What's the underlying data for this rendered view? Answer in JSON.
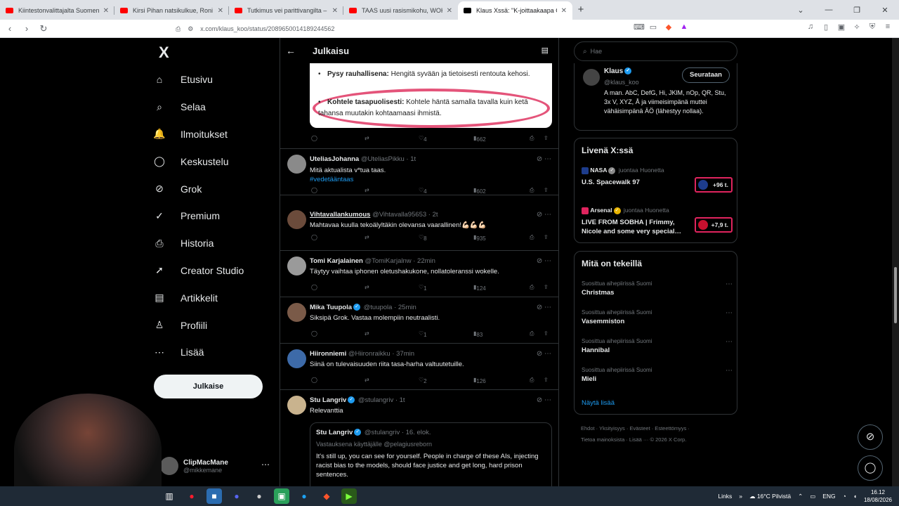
{
  "browser": {
    "tabs": [
      {
        "title": "Kiintestonvalittajalta Suomen suur",
        "fav": "#ff0000"
      },
      {
        "title": "Kirsi Pihan natsikulkue, Roni heittelli",
        "fav": "#ff0000"
      },
      {
        "title": "Tutkimus vei parittivangilta – Atte Ka",
        "fav": "#ff0000"
      },
      {
        "title": "TAAS uusi rasismikohu, WOKE-profe",
        "fav": "#ff0000"
      },
      {
        "title": "Klaus Xssä: \"K-joittaakaapa Goog",
        "fav": "#000000"
      }
    ],
    "new_tab": "+",
    "url": "x.com/klaus_koo/status/2089650014189244562"
  },
  "x": {
    "logo": "X",
    "nav": [
      {
        "label": "Etusivu",
        "icon": "⌂"
      },
      {
        "label": "Selaa",
        "icon": "⌕"
      },
      {
        "label": "Ilmoitukset",
        "icon": "🔔"
      },
      {
        "label": "Keskustelu",
        "icon": "◯"
      },
      {
        "label": "Grok",
        "icon": "⊘"
      },
      {
        "label": "Premium",
        "icon": "✓"
      },
      {
        "label": "Historia",
        "icon": "⎙"
      },
      {
        "label": "Creator Studio",
        "icon": "➚"
      },
      {
        "label": "Artikkelit",
        "icon": "▤"
      },
      {
        "label": "Profiili",
        "icon": "♙"
      },
      {
        "label": "Lisää",
        "icon": "⋯"
      }
    ],
    "post_button": "Julkaise",
    "account": {
      "name": "ClipMacMane",
      "handle": "@mikkemane"
    }
  },
  "main": {
    "header_title": "Julkaisu",
    "image": {
      "line1_bold": "Pysy rauhallisena:",
      "line1_text": " Hengitä syvään ja tietoisesti rentouta kehosi.",
      "line2_bold": "Kohtele tasapuolisesti:",
      "line2_text": " Kohtele häntä samalla tavalla kuin ketä tahansa muutakin kohtaamaasi ihmistä."
    },
    "first_actions": {
      "likes": "4",
      "views": "662"
    },
    "replies": [
      {
        "name": "UteliasJohanna",
        "handle": "@UteliasPikku · 1t",
        "text": "Mitä aktualista v*tua taas.",
        "tag": "#vedetääntaas",
        "likes": "4",
        "views": "602"
      },
      {
        "name": "Vihtavallankumous",
        "handle": "@Vihtavalla95653 · 2t",
        "text": "Mahtavaa kuulla tekoälyltäkin olevansa vaarallinen!💪🏻💪🏻💪🏻",
        "likes": "8",
        "views": "935"
      },
      {
        "name": "Tomi Karjalainen",
        "handle": "@TomiKarjalnw · 22min",
        "text": "Täytyy vaihtaa iphonen oletushakukone, nollatoleranssi wokelle.",
        "likes": "1",
        "views": "124"
      },
      {
        "name": "Mika Tuupola",
        "handle": "@tuupola · 25min",
        "text": "Siksipä Grok. Vastaa molempiin neutraalisti.",
        "likes": "1",
        "views": "83"
      },
      {
        "name": "Hiironniemi",
        "handle": "@Hiironraikku · 37min",
        "text": "Siinä on tulevaisuuden riita tasa-harha valtuutetuille.",
        "likes": "2",
        "views": "126"
      }
    ],
    "last": {
      "name": "Stu Langriv",
      "handle": "@stulangriv · 1t",
      "text": "Relevanttia",
      "quote_name": "Stu Langriv",
      "quote_handle": "@stulangriv · 16. elok.",
      "quote_reply": "Vastauksena käyttäjälle @pelagiusreborn",
      "quote_text": "It's still up, you can see for yourself. People in charge of these AIs, injecting racist bias to the models, should face justice and get long, hard prison sentences."
    }
  },
  "right": {
    "search_placeholder": "Hae",
    "profile": {
      "name": "Klaus",
      "handle": "@klaus_koo",
      "follow": "Seurataan",
      "bio": "A man. AbC, DefG, Hi, JKlM, nOp, QR, Stu, 3x V, XYZ, Å ja viimeisimpänä muttei vähäisimpänä ÄÖ (lähestyy nollaa)."
    },
    "live_title": "Livenä X:ssä",
    "live": [
      {
        "source": "NASA",
        "hosting": " juontaa Huonetta",
        "title": "U.S. Spacewalk 97",
        "count": "+96 t."
      },
      {
        "source": "Arsenal",
        "hosting": " juontaa Huonetta",
        "title": "LIVE FROM SOBHA | Frimmy, Nicole and some very special…",
        "count": "+7,9 t."
      }
    ],
    "trends_title": "Mitä on tekeillä",
    "trends": [
      {
        "context": "Suosittua aihepiirissä Suomi",
        "topic": "Christmas"
      },
      {
        "context": "Suosittua aihepiirissä Suomi",
        "topic": "Vasemmiston"
      },
      {
        "context": "Suosittua aihepiirissä Suomi",
        "topic": "Hannibal"
      },
      {
        "context": "Suosittua aihepiirissä Suomi",
        "topic": "Mieli"
      }
    ],
    "show_more": "Näytä lisää",
    "footer_line1": "Ehdot · Yksityisyys · Evästeet · Esteettömyys ·",
    "footer_line2": "Tietoa mainoksista · Lisää ··· © 2026 X Corp."
  },
  "taskbar": {
    "links": "Links",
    "weather": "16°C  Pilvistä",
    "lang": "ENG",
    "time": "16.12",
    "date": "18/08/2026"
  }
}
